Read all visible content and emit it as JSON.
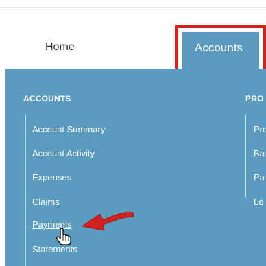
{
  "nav": {
    "home_label": "Home",
    "accounts_label": "Accounts"
  },
  "menu": {
    "accounts_heading": "ACCOUNTS",
    "accounts_items": [
      {
        "label": "Account Summary"
      },
      {
        "label": "Account Activity"
      },
      {
        "label": "Expenses"
      },
      {
        "label": "Claims"
      },
      {
        "label": "Payments"
      },
      {
        "label": "Statements"
      }
    ],
    "second_heading": "PRO",
    "second_items": [
      {
        "label": "Pro"
      },
      {
        "label": "Ba"
      },
      {
        "label": "Pa"
      },
      {
        "label": "Lo"
      }
    ]
  },
  "colors": {
    "menu_background": "#5b9bbf",
    "highlight": "#d42020"
  },
  "icons": {
    "annotation_arrow": "red-arrow-icon",
    "cursor": "hand-cursor-icon"
  }
}
